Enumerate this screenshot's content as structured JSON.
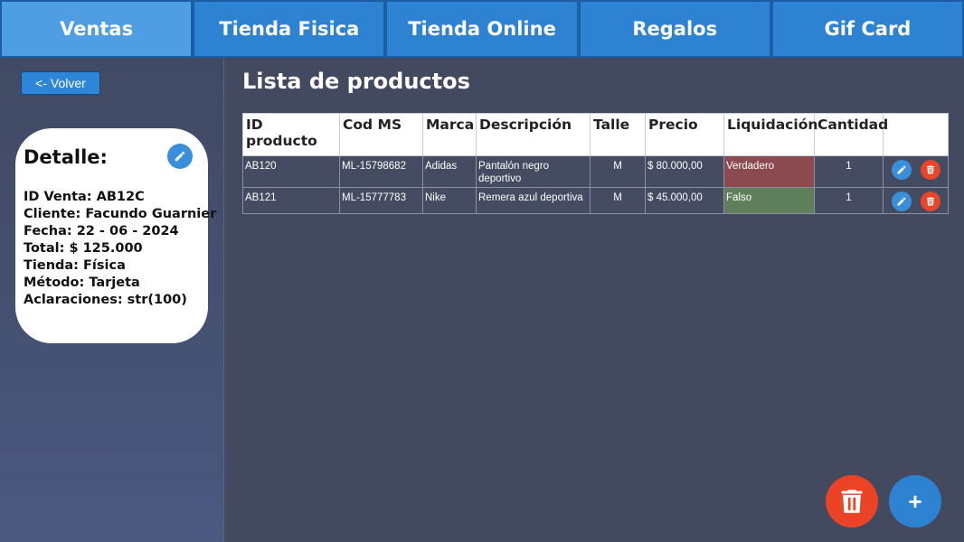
{
  "nav": {
    "tabs": [
      {
        "label": "Ventas",
        "active": true
      },
      {
        "label": "Tienda Fisica",
        "active": false
      },
      {
        "label": "Tienda Online",
        "active": false
      },
      {
        "label": "Regalos",
        "active": false
      },
      {
        "label": "Gif Card",
        "active": false
      }
    ]
  },
  "sidebar": {
    "back_label": "<- Volver",
    "detail": {
      "title": "Detalle:",
      "lines": [
        "ID Venta: AB12C",
        "Cliente: Facundo Guarnier",
        "Fecha: 22 - 06 - 2024",
        "Total: $ 125.000",
        "Tienda: Física",
        "Método: Tarjeta",
        "Aclaraciones: str(100)"
      ],
      "edit_icon": "pencil-icon"
    }
  },
  "main": {
    "title": "Lista de productos",
    "columns": [
      "ID producto",
      "Cod MS",
      "Marca",
      "Descripción",
      "Talle",
      "Precio",
      "Liquidación",
      "Cantidad",
      ""
    ],
    "rows": [
      {
        "id": "AB120",
        "cod": "ML-15798682",
        "marca": "Adidas",
        "desc": "Pantalón negro deportivo",
        "talle": "M",
        "precio": "$ 80.000,00",
        "liquidacion": "Verdadero",
        "cantidad": "1"
      },
      {
        "id": "AB121",
        "cod": "ML-15777783",
        "marca": "Nike",
        "desc": "Remera azul deportiva",
        "talle": "M",
        "precio": "$ 45.000,00",
        "liquidacion": "Falso",
        "cantidad": "1"
      }
    ],
    "fab_add_label": "+"
  },
  "colors": {
    "accent": "#2d82d2",
    "danger": "#ea4325",
    "liq_true": "#8a4a4f",
    "liq_false": "#5f7f5c"
  }
}
